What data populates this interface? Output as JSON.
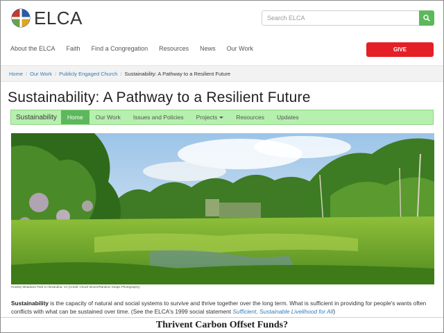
{
  "header": {
    "logo_text": "ELCA",
    "search_placeholder": "Search ELCA",
    "give_label": "GIVE",
    "nav": [
      "About the ELCA",
      "Faith",
      "Find a Congregation",
      "Resources",
      "News",
      "Our Work"
    ]
  },
  "breadcrumb": {
    "items": [
      "Home",
      "Our Work",
      "Publicly Engaged Church"
    ],
    "current": "Sustainability: A Pathway to a Resilient Future"
  },
  "page": {
    "title": "Sustainability: A Pathway to a Resilient Future"
  },
  "subnav": {
    "brand": "Sustainability",
    "items": [
      "Home",
      "Our Work",
      "Issues and Policies",
      "Projects",
      "Resources",
      "Updates"
    ],
    "active": "Home"
  },
  "photo": {
    "caption": "Huntley Meadows Park in Alexandria, VA (Credit: Chuck Moore/Random Snaps Photography)"
  },
  "body": {
    "term": "Sustainability",
    "text": " is the capacity of natural and social systems to survive and thrive together over the long term. What is sufficient in providing for people's wants often conflicts with what can be sustained over time. (See the ELCA's 1999 social statement ",
    "link": "Sufficient, Sustainable Livelihood for All",
    "tail": ")"
  },
  "footer": {
    "text": "Thrivent Carbon Offset Funds?"
  },
  "colors": {
    "accent_green": "#5cb85c",
    "subnav_bg": "#b6f0ae",
    "give_red": "#e41f26",
    "link_blue": "#337ab7"
  }
}
